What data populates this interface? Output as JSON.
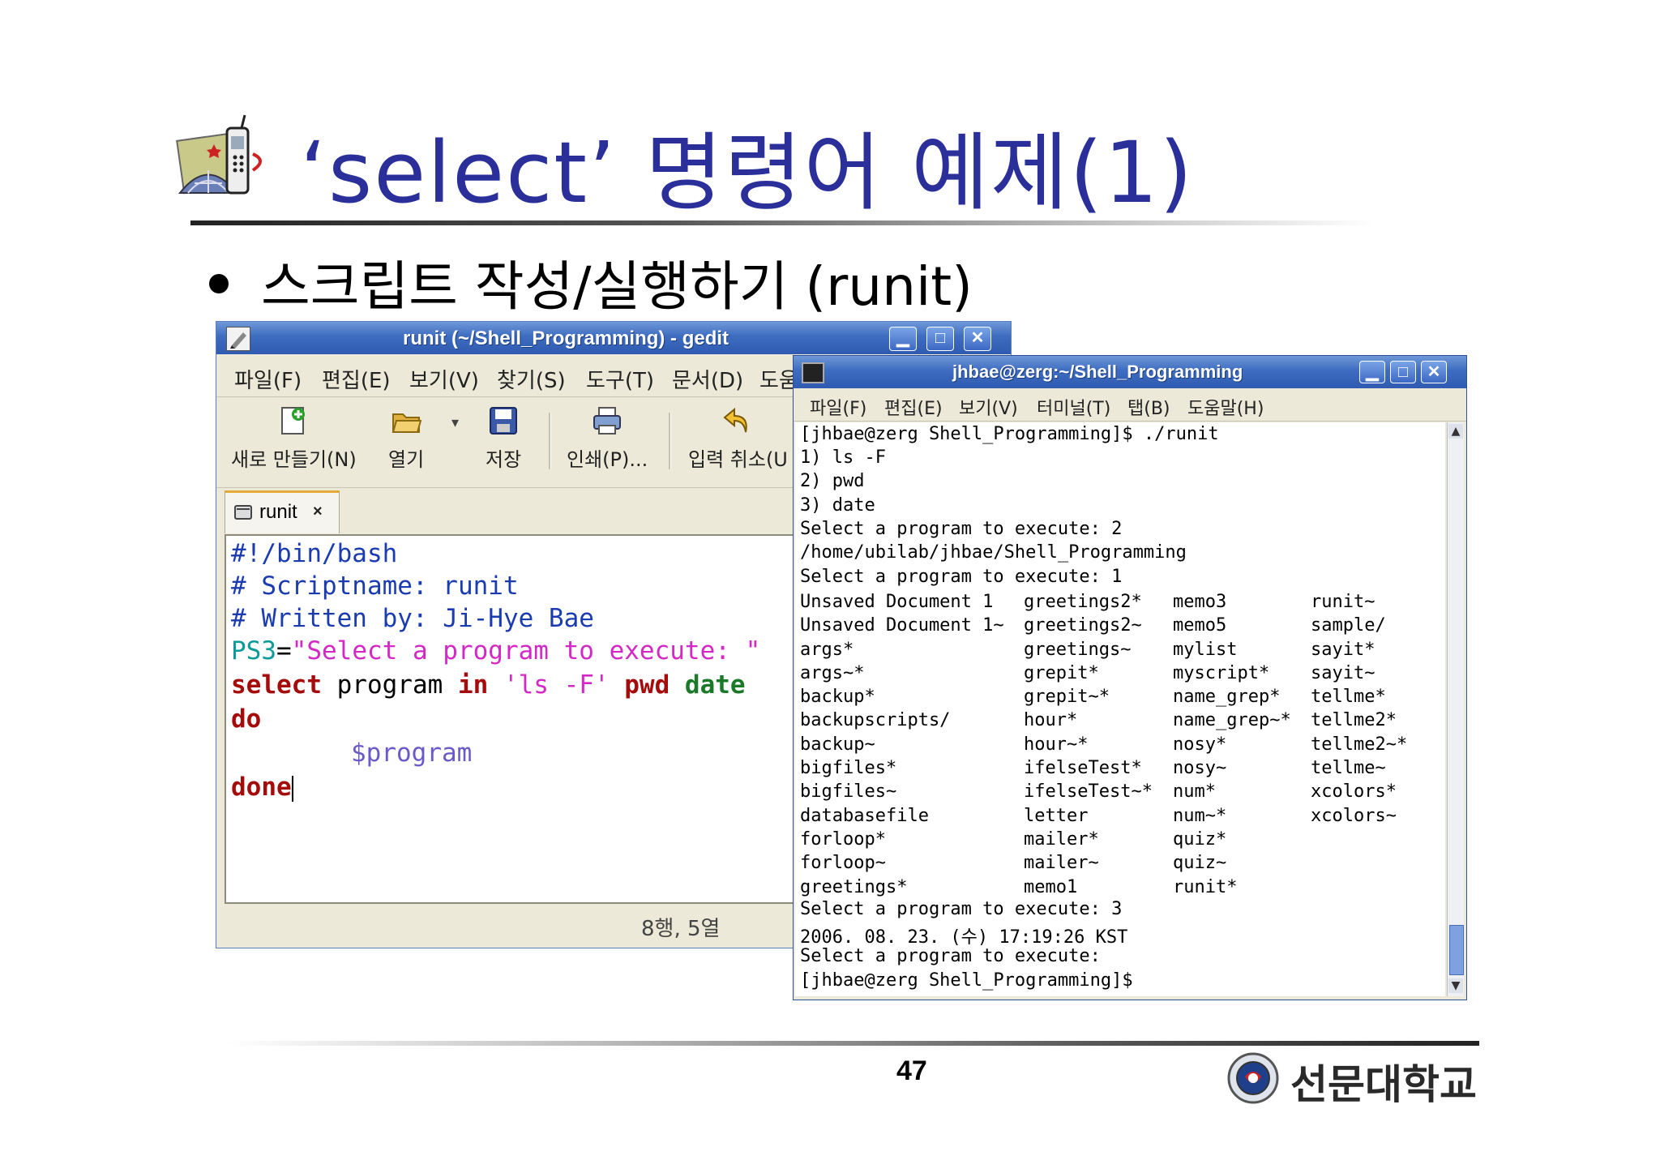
{
  "slide": {
    "title": "‘select’ 명령어 예제(1)",
    "bullet": "스크립트 작성/실행하기 (runit)",
    "page_number": "47",
    "university": "선문대학교"
  },
  "gedit": {
    "title": "runit (~/Shell_Programming) - gedit",
    "menu": [
      "파일(F)",
      "편집(E)",
      "보기(V)",
      "찾기(S)",
      "도구(T)",
      "문서(D)",
      "도움"
    ],
    "toolbar": {
      "new": "새로 만들기(N)",
      "open": "열기",
      "save": "저장",
      "print": "인쇄(P)...",
      "undo": "입력 취소(U"
    },
    "tab_label": "runit",
    "code": {
      "line1": "#!/bin/bash",
      "line2": "# Scriptname: runit",
      "line3": "# Written by: Ji-Hye Bae",
      "line4_var": "PS3",
      "line4_eq": "=",
      "line4_str": "\"Select a program to execute: \"",
      "line5_kw": "select",
      "line5_a": " program ",
      "line5_in": "in",
      "line5_str": " 'ls -F'",
      "line5_pwd": " pwd",
      "line5_date": " date",
      "line6": "do",
      "line7": "$program",
      "line8": "done"
    },
    "status": "8행, 5열"
  },
  "terminal": {
    "title": "jhbae@zerg:~/Shell_Programming",
    "menu": [
      "파일(F)",
      "편집(E)",
      "보기(V)",
      "터미널(T)",
      "탭(B)",
      "도움말(H)"
    ],
    "lines_top": [
      "[jhbae@zerg Shell_Programming]$ ./runit",
      "1) ls -F",
      "2) pwd",
      "3) date",
      "Select a program to execute: 2",
      "/home/ubilab/jhbae/Shell_Programming",
      "Select a program to execute: 1"
    ],
    "col1": [
      "Unsaved Document 1",
      "Unsaved Document 1~",
      "args*",
      "args~*",
      "backup*",
      "backupscripts/",
      "backup~",
      "bigfiles*",
      "bigfiles~",
      "databasefile",
      "forloop*",
      "forloop~",
      "greetings*"
    ],
    "col2": [
      "greetings2*",
      "greetings2~",
      "greetings~",
      "grepit*",
      "grepit~*",
      "hour*",
      "hour~*",
      "ifelseTest*",
      "ifelseTest~*",
      "letter",
      "mailer*",
      "mailer~",
      "memo1"
    ],
    "col3": [
      "memo3",
      "memo5",
      "mylist",
      "myscript*",
      "name_grep*",
      "name_grep~*",
      "nosy*",
      "nosy~",
      "num*",
      "num~*",
      "quiz*",
      "quiz~",
      "runit*"
    ],
    "col4": [
      "runit~",
      "sample/",
      "sayit*",
      "sayit~",
      "tellme*",
      "tellme2*",
      "tellme2~*",
      "tellme~",
      "xcolors*",
      "xcolors~"
    ],
    "lines_bottom": [
      "Select a program to execute: 3",
      "2006. 08. 23. (수) 17:19:26 KST",
      "Select a program to execute:",
      "[jhbae@zerg Shell_Programming]$"
    ]
  },
  "colors": {
    "title_text": "#2b2f9a",
    "titlebar_blue": "#3d6cc0",
    "comment": "#1a3cb0",
    "string": "#d428c6",
    "keyword": "#a50b0b"
  }
}
